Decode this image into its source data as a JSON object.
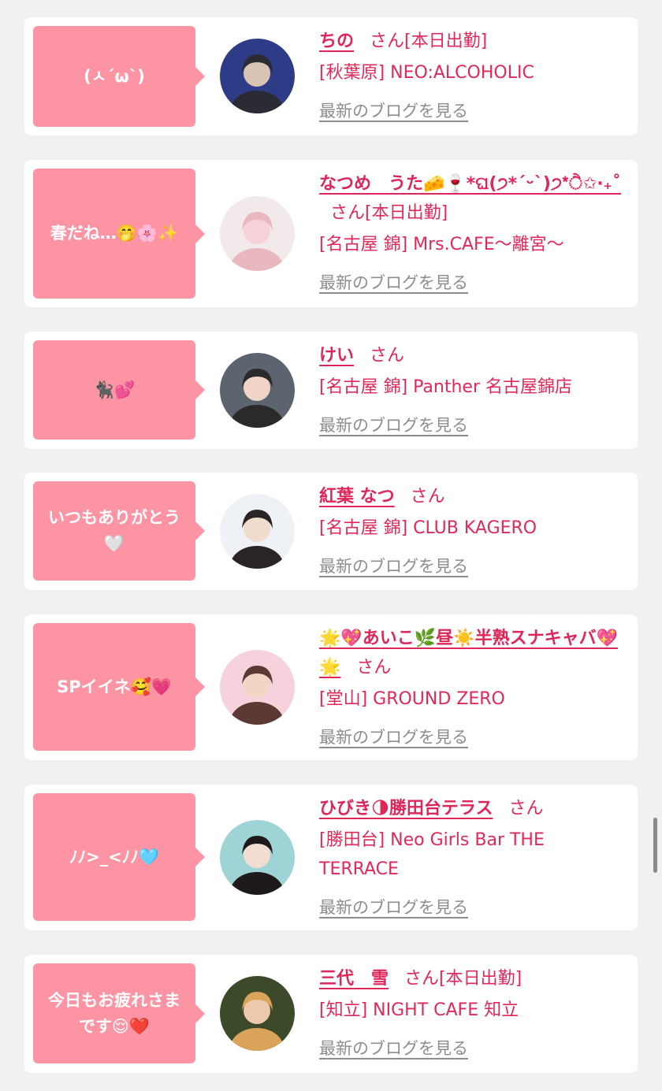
{
  "san": "さん",
  "blog_link": "最新のブログを見る",
  "cards": [
    {
      "bubble": [
        "(ㅅ´ω`)"
      ],
      "name": "ちの",
      "status": "[本日出勤]",
      "shop": "[秋葉原] NEO:ALCOHOLIC",
      "avatar_colors": [
        "#2e3b86",
        "#d9c3b3",
        "#2b2b33"
      ]
    },
    {
      "bubble": [
        "春だね…🤭🌸✨"
      ],
      "name": "なつめ　うた🧀🍷*ଘ(੭*ˊᵕˋ)੭*ੈ✩‧₊˚",
      "status": "[本日出勤]",
      "shop": "[名古屋 錦] Mrs.CAFE〜離宮〜",
      "avatar_colors": [
        "#f1e9ea",
        "#f5d2d8",
        "#e8b8be"
      ]
    },
    {
      "bubble": [
        "🐈‍⬛💕"
      ],
      "name": "けい",
      "status": "",
      "shop": "[名古屋 錦] Panther 名古屋錦店",
      "avatar_colors": [
        "#5c6470",
        "#f0d5c6",
        "#2a2a2a"
      ]
    },
    {
      "bubble": [
        "いつもありがとう",
        "🤍"
      ],
      "name": "紅葉 なつ",
      "status": "",
      "shop": "[名古屋 錦] CLUB KAGERO",
      "avatar_colors": [
        "#eef1f6",
        "#efdccd",
        "#2b2426"
      ]
    },
    {
      "bubble": [
        "SPイイネ🥰💗"
      ],
      "name": "🌟💖あいこ🌿昼☀️半熟スナキャバ💖🌟",
      "status": "",
      "shop": "[堂山] GROUND ZERO",
      "avatar_colors": [
        "#f6d3dc",
        "#f1d6c6",
        "#5a3a32"
      ]
    },
    {
      "bubble": [
        "ﾉﾉ>_<ﾉﾉ🩵"
      ],
      "name": "ひびき🌗勝田台テラス",
      "status": "",
      "shop": "[勝田台] Neo Girls Bar THE TERRACE",
      "avatar_colors": [
        "#9fd4d6",
        "#f3ddd0",
        "#1e1a1c"
      ]
    },
    {
      "bubble": [
        "今日もお疲れさま",
        "です😌❤️"
      ],
      "name": "三代　雪",
      "status": "[本日出勤]",
      "shop": "[知立] NIGHT CAFE 知立",
      "avatar_colors": [
        "#3d4a2a",
        "#ecc9ad",
        "#d9a35a"
      ]
    }
  ]
}
